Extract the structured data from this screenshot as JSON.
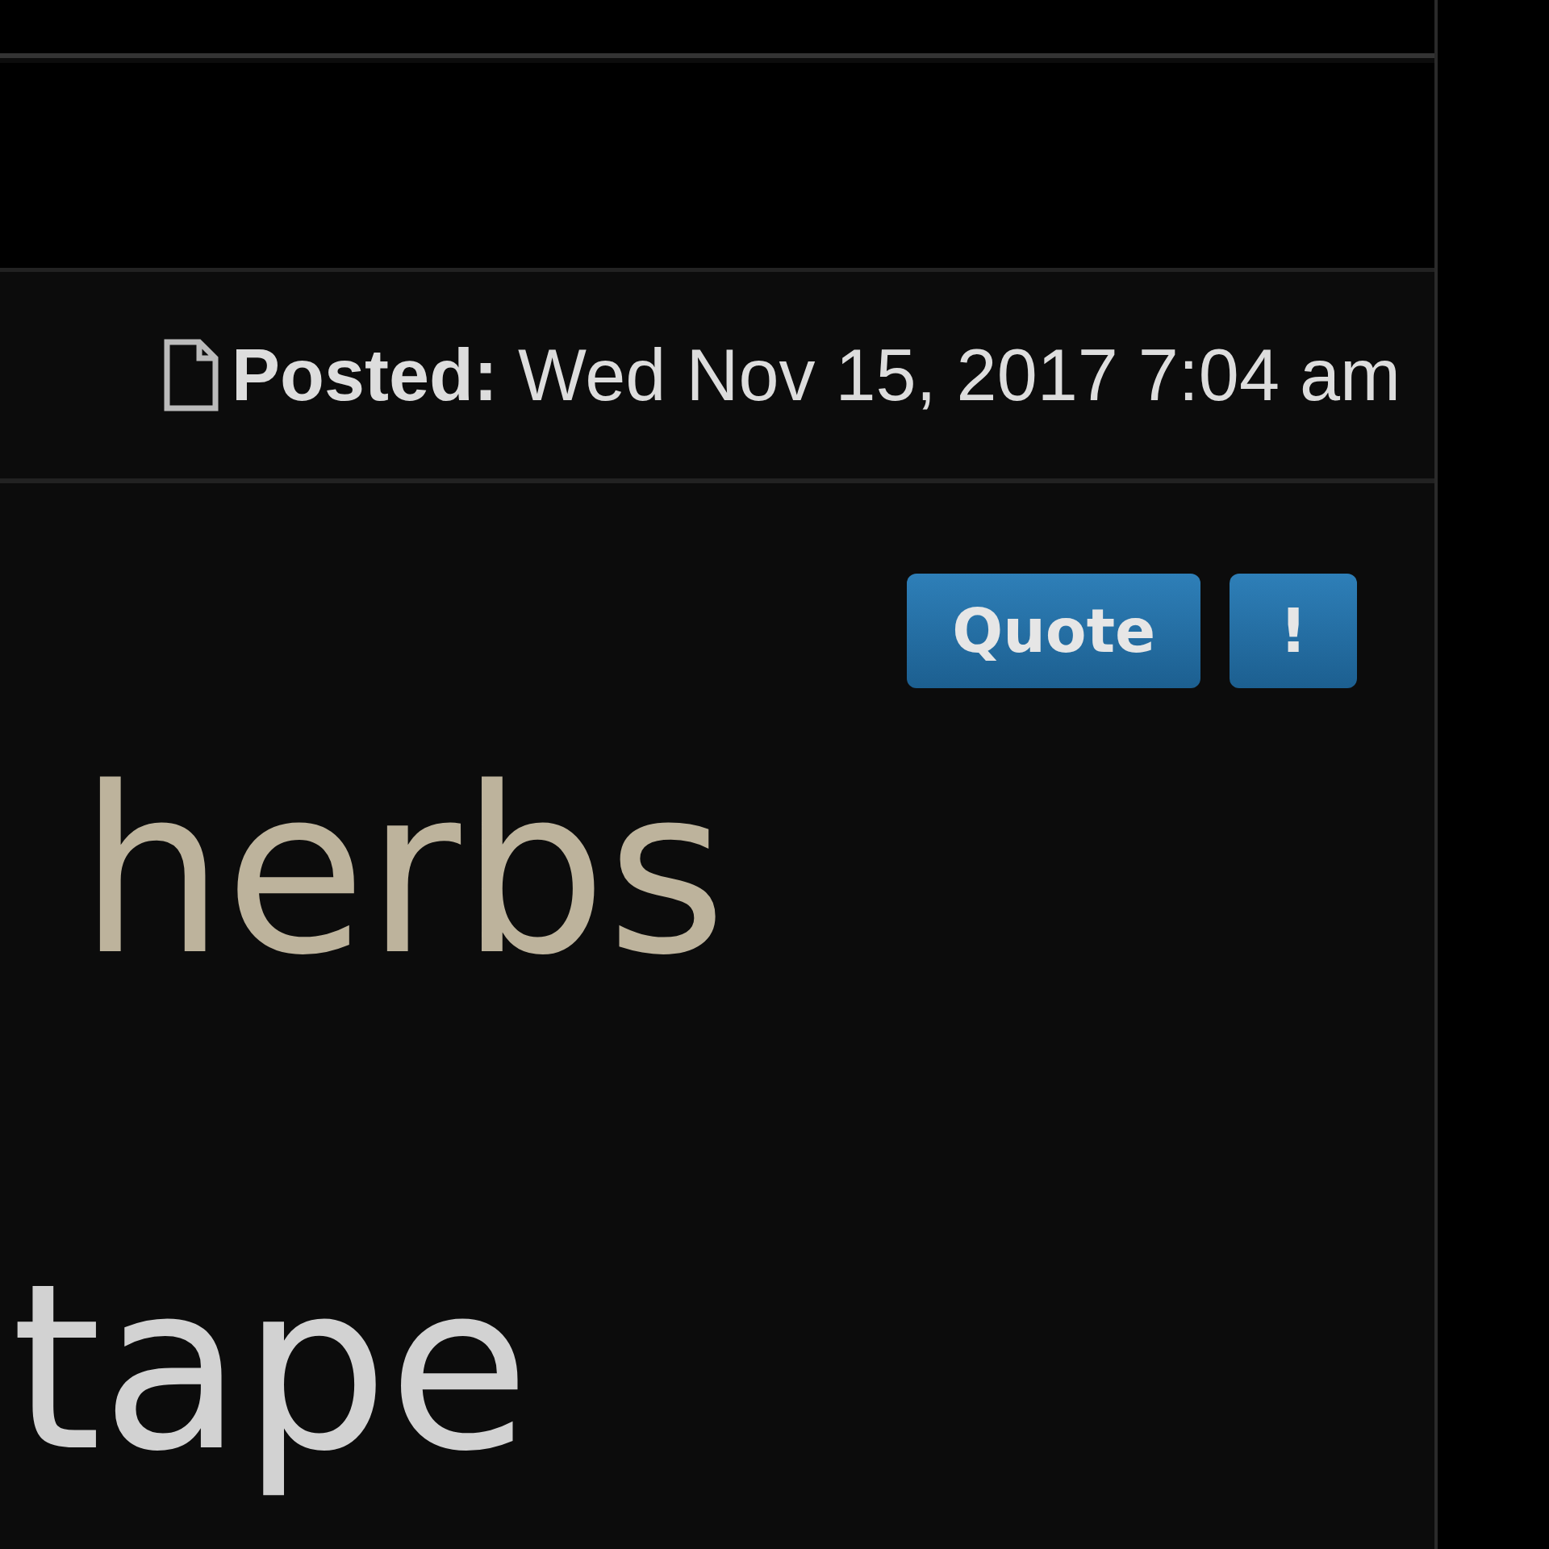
{
  "post": {
    "label": "Posted:",
    "date": "Wed Nov 15, 2017 7:04 am"
  },
  "buttons": [
    {
      "label": "Quote"
    },
    {
      "label": "!"
    }
  ],
  "body": [
    {
      "text": "herbs",
      "kind": "tan"
    },
    {
      "text": "tape",
      "kind": "grey"
    }
  ]
}
